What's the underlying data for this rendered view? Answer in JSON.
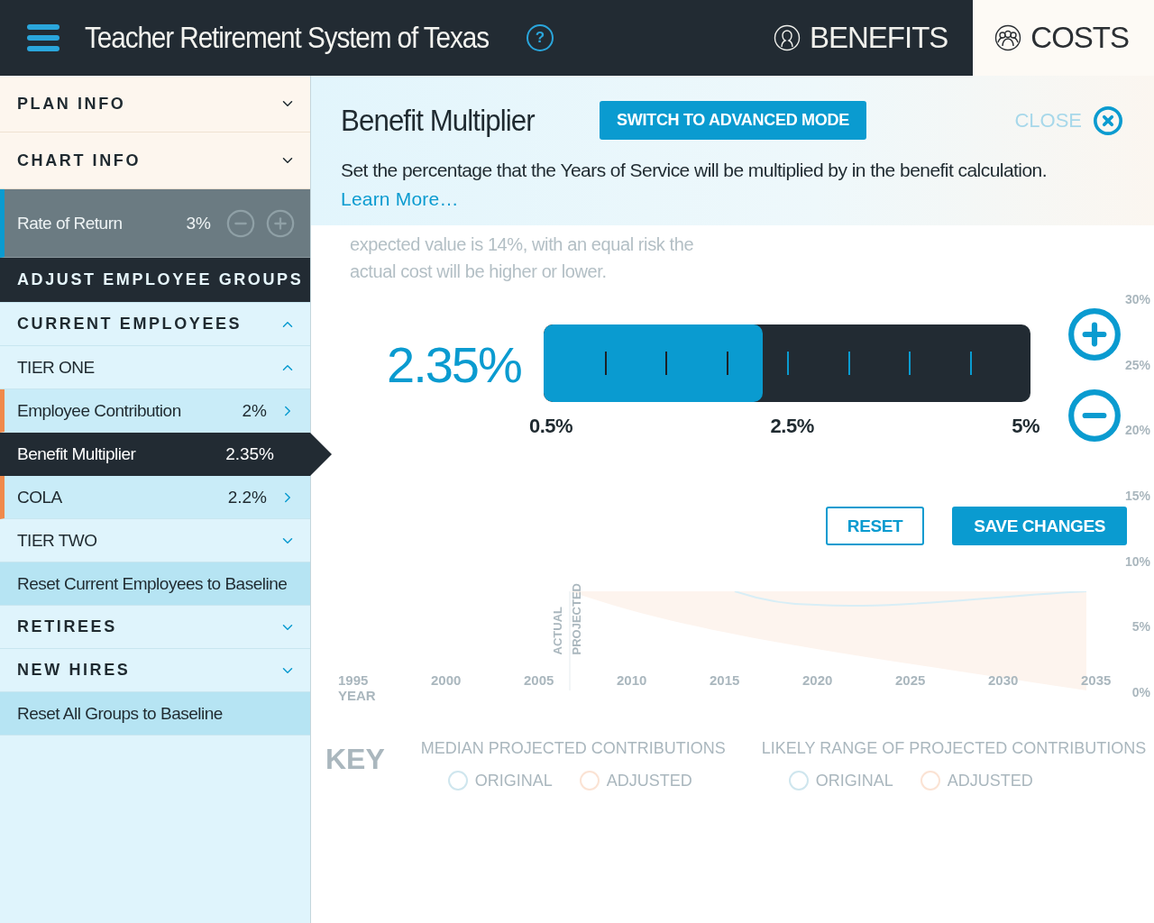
{
  "header": {
    "title": "Teacher Retirement System of Texas",
    "help_label": "?",
    "tabs": [
      {
        "label": "BENEFITS",
        "selected": false
      },
      {
        "label": "COSTS",
        "selected": true
      }
    ]
  },
  "sidebar": {
    "items": [
      {
        "kind": "section",
        "label": "PLAN INFO",
        "expanded": false
      },
      {
        "kind": "section",
        "label": "CHART INFO",
        "expanded": false
      },
      {
        "kind": "rate",
        "label": "Rate of Return",
        "value": "3%"
      },
      {
        "kind": "heading",
        "label": "ADJUST EMPLOYEE GROUPS"
      },
      {
        "kind": "group",
        "label": "CURRENT EMPLOYEES",
        "expanded": true
      },
      {
        "kind": "tier",
        "label": "TIER ONE",
        "expanded": true
      },
      {
        "kind": "param",
        "label": "Employee Contribution",
        "value": "2%",
        "selected": false
      },
      {
        "kind": "param",
        "label": "Benefit Multiplier",
        "value": "2.35%",
        "selected": true
      },
      {
        "kind": "param",
        "label": "COLA",
        "value": "2.2%",
        "selected": false
      },
      {
        "kind": "tier",
        "label": "TIER TWO",
        "expanded": false
      },
      {
        "kind": "reset",
        "label": "Reset Current Employees to Baseline"
      },
      {
        "kind": "group",
        "label": "RETIREES",
        "expanded": false
      },
      {
        "kind": "group",
        "label": "NEW HIRES",
        "expanded": false
      },
      {
        "kind": "reset",
        "label": "Reset All Groups to Baseline"
      }
    ]
  },
  "editor": {
    "title": "Benefit Multiplier",
    "mode_button": "SWITCH TO ADVANCED MODE",
    "close_label": "CLOSE",
    "description": "Set the percentage that the Years of Service will be multiplied by in the benefit calculation.",
    "link": "Learn More…",
    "value": "2.35%",
    "level": 0.45,
    "scale": [
      "0.5%",
      "2.5%",
      "5%"
    ],
    "buttons": [
      {
        "label": "RESET",
        "kind": "secondary"
      },
      {
        "label": "SAVE CHANGES",
        "kind": "primary"
      }
    ]
  },
  "background": {
    "note": [
      "expected value is 14%, with an equal risk the",
      "actual cost will be higher or lower."
    ],
    "y_labels": [
      "30%",
      "25%",
      "20%",
      "15%",
      "10%",
      "5%",
      "0%"
    ],
    "x_labels": [
      "1995",
      "2000",
      "2005",
      "2010",
      "2015",
      "2020",
      "2025",
      "2030",
      "2035"
    ],
    "x_title": "YEAR",
    "divider_labels": [
      "ACTUAL",
      "PROJECTED"
    ],
    "key_title": "KEY",
    "legend": [
      {
        "title": "MEDIAN PROJECTED CONTRIBUTIONS",
        "items": [
          {
            "label": "ORIGINAL",
            "color": "#cfe6ee"
          },
          {
            "label": "ADJUSTED",
            "color": "#fbe3d4"
          }
        ]
      },
      {
        "title": "LIKELY RANGE OF PROJECTED CONTRIBUTIONS",
        "items": [
          {
            "label": "ORIGINAL",
            "color": "#cfe6ee"
          },
          {
            "label": "ADJUSTED",
            "color": "#fbe3d4"
          }
        ]
      }
    ]
  }
}
